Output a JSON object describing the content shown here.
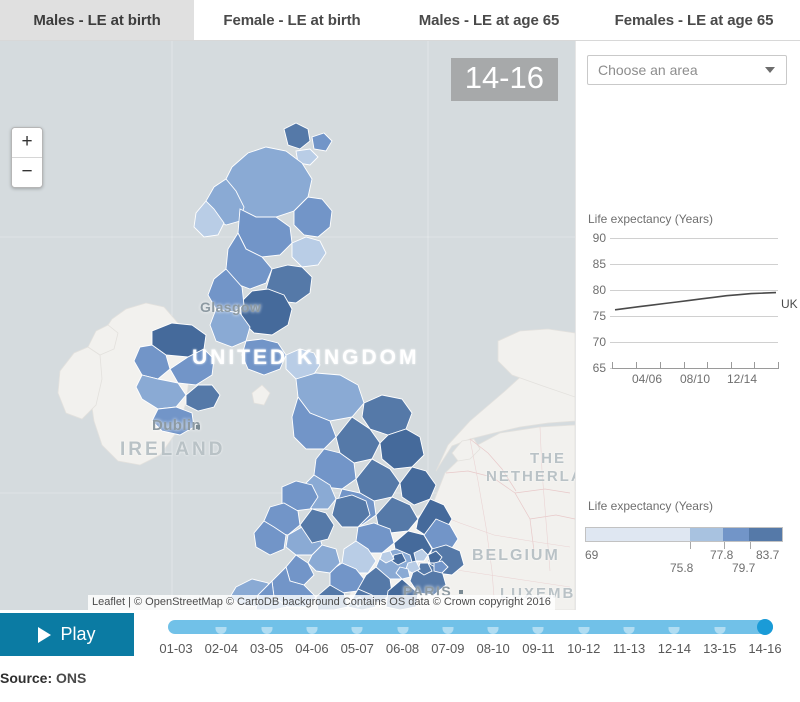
{
  "tabs": [
    {
      "label": "Males - LE at birth",
      "active": true
    },
    {
      "label": "Female - LE at birth",
      "active": false
    },
    {
      "label": "Males - LE at age 65",
      "active": false
    },
    {
      "label": "Females - LE at age 65",
      "active": false
    }
  ],
  "map": {
    "year_badge": "14-16",
    "zoom_in_label": "+",
    "zoom_out_label": "−",
    "attribution": "Leaflet | © OpenStreetMap © CartoDB background Contains OS data © Crown copyright 2016",
    "sea_color": "#d5dbde",
    "labels": [
      {
        "text": "UNITED KINGDOM",
        "style": "white"
      },
      {
        "text": "IRELAND",
        "style": "grey"
      },
      {
        "text": "THE",
        "style": "grey"
      },
      {
        "text": "NETHERLANDS",
        "style": "grey"
      },
      {
        "text": "BELGIUM",
        "style": "grey"
      },
      {
        "text": "LUXEMBOURG",
        "style": "grey"
      },
      {
        "text": "Glasgow",
        "style": "city"
      },
      {
        "text": "Dublin",
        "style": "city"
      },
      {
        "text": "PARIS",
        "style": "city"
      }
    ]
  },
  "sidebar": {
    "area_select": {
      "placeholder": "Choose an area",
      "caret": "chevron-down-icon"
    },
    "legend": {
      "title": "Life expectancy (Years)",
      "colors": [
        "#dfe7f2",
        "#a8c2e0",
        "#7295c8",
        "#5579a8"
      ],
      "breaks": [
        "69",
        "75.8",
        "77.8",
        "79.7",
        "83.7"
      ]
    }
  },
  "chart_data": {
    "type": "line",
    "title": "Life expectancy (Years)",
    "xlabel": "",
    "ylabel": "Life expectancy (Years)",
    "ylim": [
      63,
      91
    ],
    "yticks": [
      90,
      85,
      80,
      75,
      70,
      65
    ],
    "x": [
      "01-03",
      "02-04",
      "03-05",
      "04-06",
      "05-07",
      "06-08",
      "07-09",
      "08-10",
      "09-11",
      "10-12",
      "11-13",
      "12-14",
      "13-15",
      "14-16"
    ],
    "xticks_labeled": [
      "04/06",
      "08/10",
      "12/14"
    ],
    "grid": true,
    "legend_position": "right",
    "series": [
      {
        "name": "UK",
        "color": "#4a4a4a",
        "values": [
          76.2,
          76.5,
          76.8,
          77.1,
          77.4,
          77.7,
          78.0,
          78.3,
          78.6,
          78.9,
          79.1,
          79.3,
          79.4,
          79.5
        ]
      }
    ]
  },
  "timeline": {
    "play_label": "Play",
    "play_icon": "play-triangle-icon",
    "current_index": 13,
    "steps": [
      "01-03",
      "02-04",
      "03-05",
      "04-06",
      "05-07",
      "06-08",
      "07-09",
      "08-10",
      "09-11",
      "10-12",
      "11-13",
      "12-14",
      "13-15",
      "14-16"
    ]
  },
  "footer": {
    "source_label": "Source:",
    "source_value": "ONS"
  }
}
